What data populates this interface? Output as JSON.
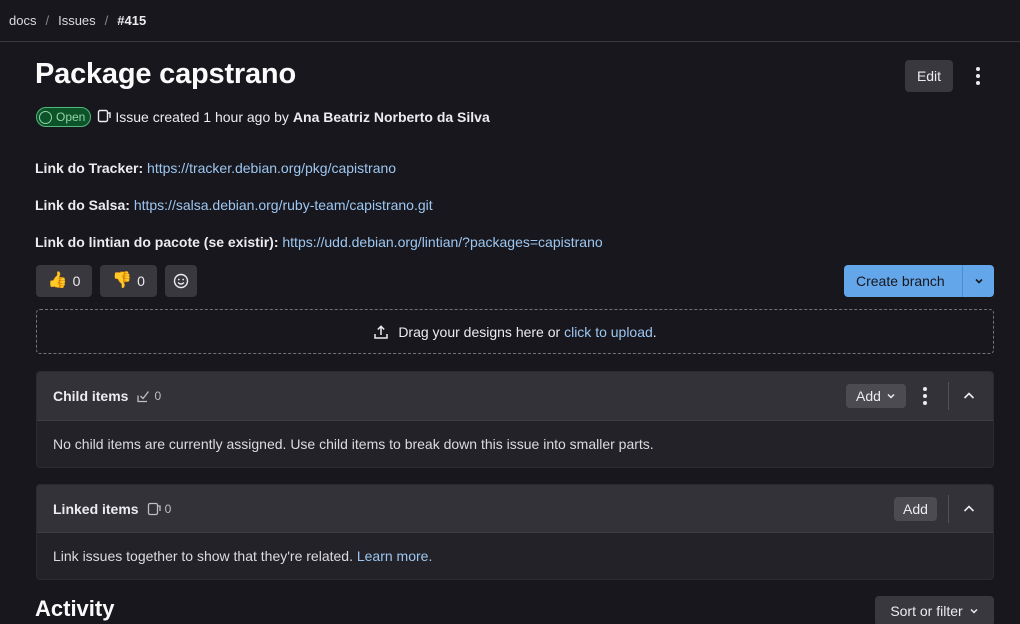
{
  "breadcrumb": {
    "items": [
      "docs",
      "Issues"
    ],
    "separator": "/",
    "current": "#415"
  },
  "issue": {
    "title": "Package capstrano",
    "status": "Open",
    "created_text": "Issue created 1 hour ago by",
    "author": "Ana Beatriz Norberto da Silva",
    "edit_label": "Edit"
  },
  "description": {
    "tracker_label": "Link do Tracker:",
    "tracker_url": "https://tracker.debian.org/pkg/capistrano",
    "salsa_label": "Link do Salsa:",
    "salsa_url": "https://salsa.debian.org/ruby-team/capistrano.git",
    "lintian_label": "Link do lintian do pacote (se existir):",
    "lintian_url": "https://udd.debian.org/lintian/?packages=capistrano"
  },
  "awards": {
    "thumbs_up_count": "0",
    "thumbs_down_count": "0",
    "thumbs_up_emoji": "👍",
    "thumbs_down_emoji": "👎"
  },
  "create_branch_label": "Create branch",
  "upload": {
    "text": "Drag your designs here or",
    "link": "click to upload",
    "suffix": "."
  },
  "child_items": {
    "title": "Child items",
    "count": "0",
    "add_label": "Add",
    "empty_text": "No child items are currently assigned. Use child items to break down this issue into smaller parts."
  },
  "linked_items": {
    "title": "Linked items",
    "count": "0",
    "add_label": "Add",
    "text": "Link issues together to show that they're related.",
    "learn_more": "Learn more."
  },
  "activity": {
    "title": "Activity",
    "sort_label": "Sort or filter"
  },
  "colors": {
    "accent": "#63a6e9",
    "open_badge": "#52b87a",
    "link": "#9dc7f1",
    "background": "#18171d"
  },
  "icons": [
    "issue-icon",
    "upload-icon",
    "task-done-icon",
    "chevron-down-icon",
    "chevron-up-icon",
    "smile-icon",
    "kebab-icon"
  ]
}
